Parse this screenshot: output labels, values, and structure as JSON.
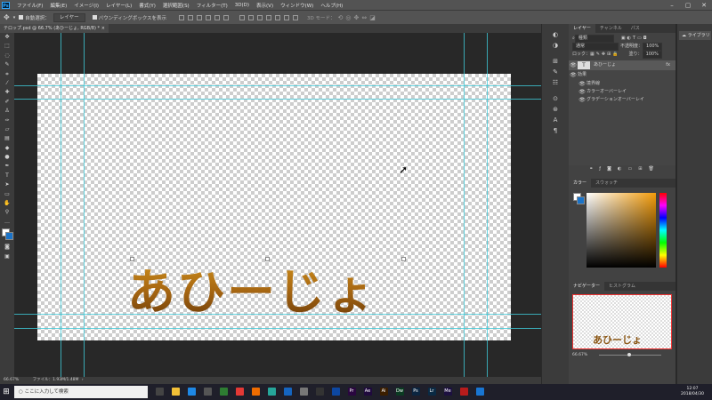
{
  "menubar": {
    "logo": "Ps",
    "items": [
      "ファイル(F)",
      "編集(E)",
      "イメージ(I)",
      "レイヤー(L)",
      "書式(Y)",
      "選択範囲(S)",
      "フィルター(T)",
      "3D(D)",
      "表示(V)",
      "ウィンドウ(W)",
      "ヘルプ(H)"
    ],
    "window_controls": [
      "–",
      "▢",
      "✕"
    ]
  },
  "options": {
    "auto_select_label": "自動選択：",
    "auto_select_value": "レイヤー",
    "bbox_label": "バウンディングボックスを表示",
    "mode_3d_label": "3D モード："
  },
  "document": {
    "tab_label": "テロップ.psd @ 66.7% (あひーじょ, RGB/8) *",
    "close": "×",
    "canvas_text": "あひーじょ"
  },
  "statusbar": {
    "zoom": "66.67%",
    "file_info": "ファイル：1.93M/1.48M"
  },
  "layers_panel": {
    "tabs": [
      "レイヤー",
      "チャンネル",
      "パス"
    ],
    "filter_label": "種類",
    "blend_mode": "通常",
    "opacity_label": "不透明度：",
    "opacity_value": "100%",
    "lock_label": "ロック：",
    "fill_label": "塗り：",
    "fill_value": "100%",
    "layer_name": "あひーじょ",
    "fx": "fx",
    "effects_label": "効果",
    "effects": [
      "境界線",
      "カラーオーバーレイ",
      "グラデーションオーバーレイ"
    ]
  },
  "color_panel": {
    "tabs": [
      "カラー",
      "スウォッチ"
    ]
  },
  "navigator_panel": {
    "tabs": [
      "ナビゲーター",
      "ヒストグラム"
    ],
    "zoom": "66.67%",
    "thumb_text": "あひーじょ"
  },
  "library": {
    "label": "ライブラリ"
  },
  "taskbar": {
    "search_placeholder": "ここに入力して検索",
    "time": "12:07",
    "date": "2018/04/30",
    "apps": [
      {
        "name": "task-view",
        "color": "#444444",
        "label": ""
      },
      {
        "name": "folder",
        "color": "#f2c037",
        "label": ""
      },
      {
        "name": "edge",
        "color": "#1e88e5",
        "label": ""
      },
      {
        "name": "store",
        "color": "#555555",
        "label": ""
      },
      {
        "name": "app-green",
        "color": "#2e7d32",
        "label": ""
      },
      {
        "name": "chrome",
        "color": "#e53935",
        "label": ""
      },
      {
        "name": "firefox",
        "color": "#ef6c00",
        "label": ""
      },
      {
        "name": "app-cyan",
        "color": "#26a69a",
        "label": ""
      },
      {
        "name": "app-blue",
        "color": "#1565c0",
        "label": ""
      },
      {
        "name": "app-gray",
        "color": "#777777",
        "label": ""
      },
      {
        "name": "app-dark",
        "color": "#333333",
        "label": ""
      },
      {
        "name": "mail",
        "color": "#0d47a1",
        "label": ""
      },
      {
        "name": "premiere",
        "color": "#2a0640",
        "label": "Pr"
      },
      {
        "name": "after-effects",
        "color": "#1f0a3d",
        "label": "Ae"
      },
      {
        "name": "illustrator",
        "color": "#3b1e00",
        "label": "Ai"
      },
      {
        "name": "dreamweaver",
        "color": "#0b3b22",
        "label": "Dw"
      },
      {
        "name": "photoshop",
        "color": "#0b2540",
        "label": "Ps"
      },
      {
        "name": "lightroom",
        "color": "#0a2a44",
        "label": "Lr"
      },
      {
        "name": "media-encoder",
        "color": "#1c1040",
        "label": "Me"
      },
      {
        "name": "acrobat",
        "color": "#b71c1c",
        "label": ""
      },
      {
        "name": "photos",
        "color": "#1976d2",
        "label": ""
      }
    ]
  }
}
